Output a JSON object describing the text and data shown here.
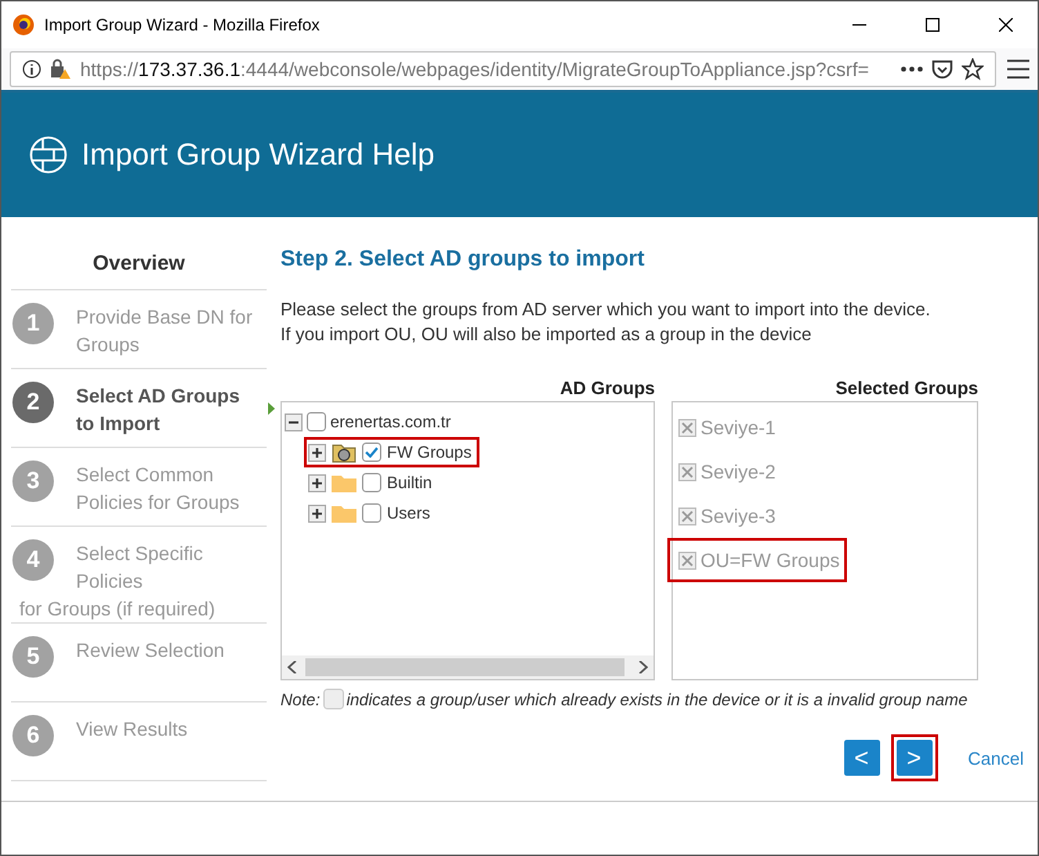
{
  "window": {
    "title": "Import Group Wizard - Mozilla Firefox"
  },
  "browser": {
    "url_scheme": "https://",
    "url_host": "173.37.36.1",
    "url_rest": ":4444/webconsole/webpages/identity/MigrateGroupToAppliance.jsp?csrf="
  },
  "header": {
    "title": "Import Group Wizard Help"
  },
  "sidebar": {
    "title": "Overview",
    "steps": [
      {
        "number": "1",
        "label": "Provide Base DN for  Groups",
        "selected": false
      },
      {
        "number": "2",
        "label": "Select AD Groups to  Import",
        "selected": true
      },
      {
        "number": "3",
        "label": "Select Common Policies  for Groups",
        "selected": false
      },
      {
        "number": "4",
        "label": "Select Specific Policies",
        "tail": "for Groups (if required)",
        "selected": false
      },
      {
        "number": "5",
        "label": "Review Selection",
        "selected": false
      },
      {
        "number": "6",
        "label": "View Results",
        "selected": false
      }
    ]
  },
  "main": {
    "heading": "Step 2. Select AD groups to import",
    "description": [
      "Please select the groups from AD server which you want to import into the device.",
      "If you import OU, OU will also be imported as a group in the device"
    ],
    "ad_groups": {
      "title": "AD Groups",
      "tree": {
        "label": "erenertas.com.tr",
        "checked": false,
        "expanded": true,
        "children": [
          {
            "label": "FW Groups",
            "checked": true,
            "expanded": false,
            "highlighted": true,
            "kind": "ou"
          },
          {
            "label": "Builtin",
            "checked": false,
            "expanded": false,
            "highlighted": false,
            "kind": "folder"
          },
          {
            "label": "Users",
            "checked": false,
            "expanded": false,
            "highlighted": false,
            "kind": "folder"
          }
        ]
      }
    },
    "selected_groups": {
      "title": "Selected Groups",
      "items": [
        {
          "label": "Seviye-1",
          "highlighted": false
        },
        {
          "label": "Seviye-2",
          "highlighted": false
        },
        {
          "label": "Seviye-3",
          "highlighted": false
        },
        {
          "label": "OU=FW Groups",
          "highlighted": true
        }
      ]
    },
    "note": {
      "prefix": "Note:",
      "text": "indicates a group/user which already exists in the device or it is a invalid group name"
    },
    "buttons": {
      "back": {
        "label": "<",
        "highlighted": false
      },
      "next": {
        "label": ">",
        "highlighted": true
      },
      "cancel": "Cancel"
    }
  }
}
